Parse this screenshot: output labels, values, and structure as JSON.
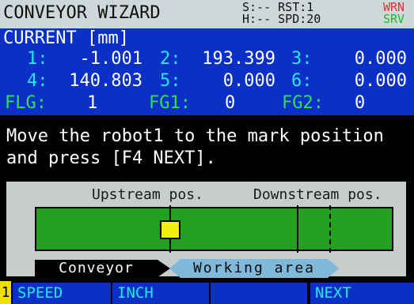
{
  "title": "CONVEYOR WIZARD",
  "status": {
    "line1": "S:-- RST:1",
    "line2": "H:-- SPD:20",
    "badge_top": "WRN",
    "badge_bottom": "SRV"
  },
  "current": {
    "header": "CURRENT [mm]",
    "axes": [
      {
        "label": "1:",
        "value": "-1.001"
      },
      {
        "label": "2:",
        "value": "193.399"
      },
      {
        "label": "3:",
        "value": "0.000"
      },
      {
        "label": "4:",
        "value": "140.803"
      },
      {
        "label": "5:",
        "value": "0.000"
      },
      {
        "label": "6:",
        "value": "0.000"
      }
    ],
    "flags": [
      {
        "label": "FLG:",
        "value": "1"
      },
      {
        "label": "FG1:",
        "value": "0"
      },
      {
        "label": "FG2:",
        "value": "0"
      }
    ]
  },
  "message": {
    "line1": "Move the robot1 to the mark position",
    "line2": "and press [F4 NEXT]."
  },
  "diagram": {
    "upstream": "Upstream pos.",
    "downstream": "Downstream pos.",
    "conveyor": "Conveyor",
    "working_area": "Working area"
  },
  "fkeys": {
    "page_number": "1",
    "keys": [
      "SPEED",
      "INCH",
      "",
      "",
      "NEXT"
    ]
  },
  "colors": {
    "title_bg": "#cfd8d8",
    "panel_bg": "#0a30c8",
    "axis_label": "#22e8e8",
    "flag_label": "#30e050",
    "belt": "#23a020",
    "mark": "#f0f010",
    "working_area": "#7fb8d8"
  }
}
